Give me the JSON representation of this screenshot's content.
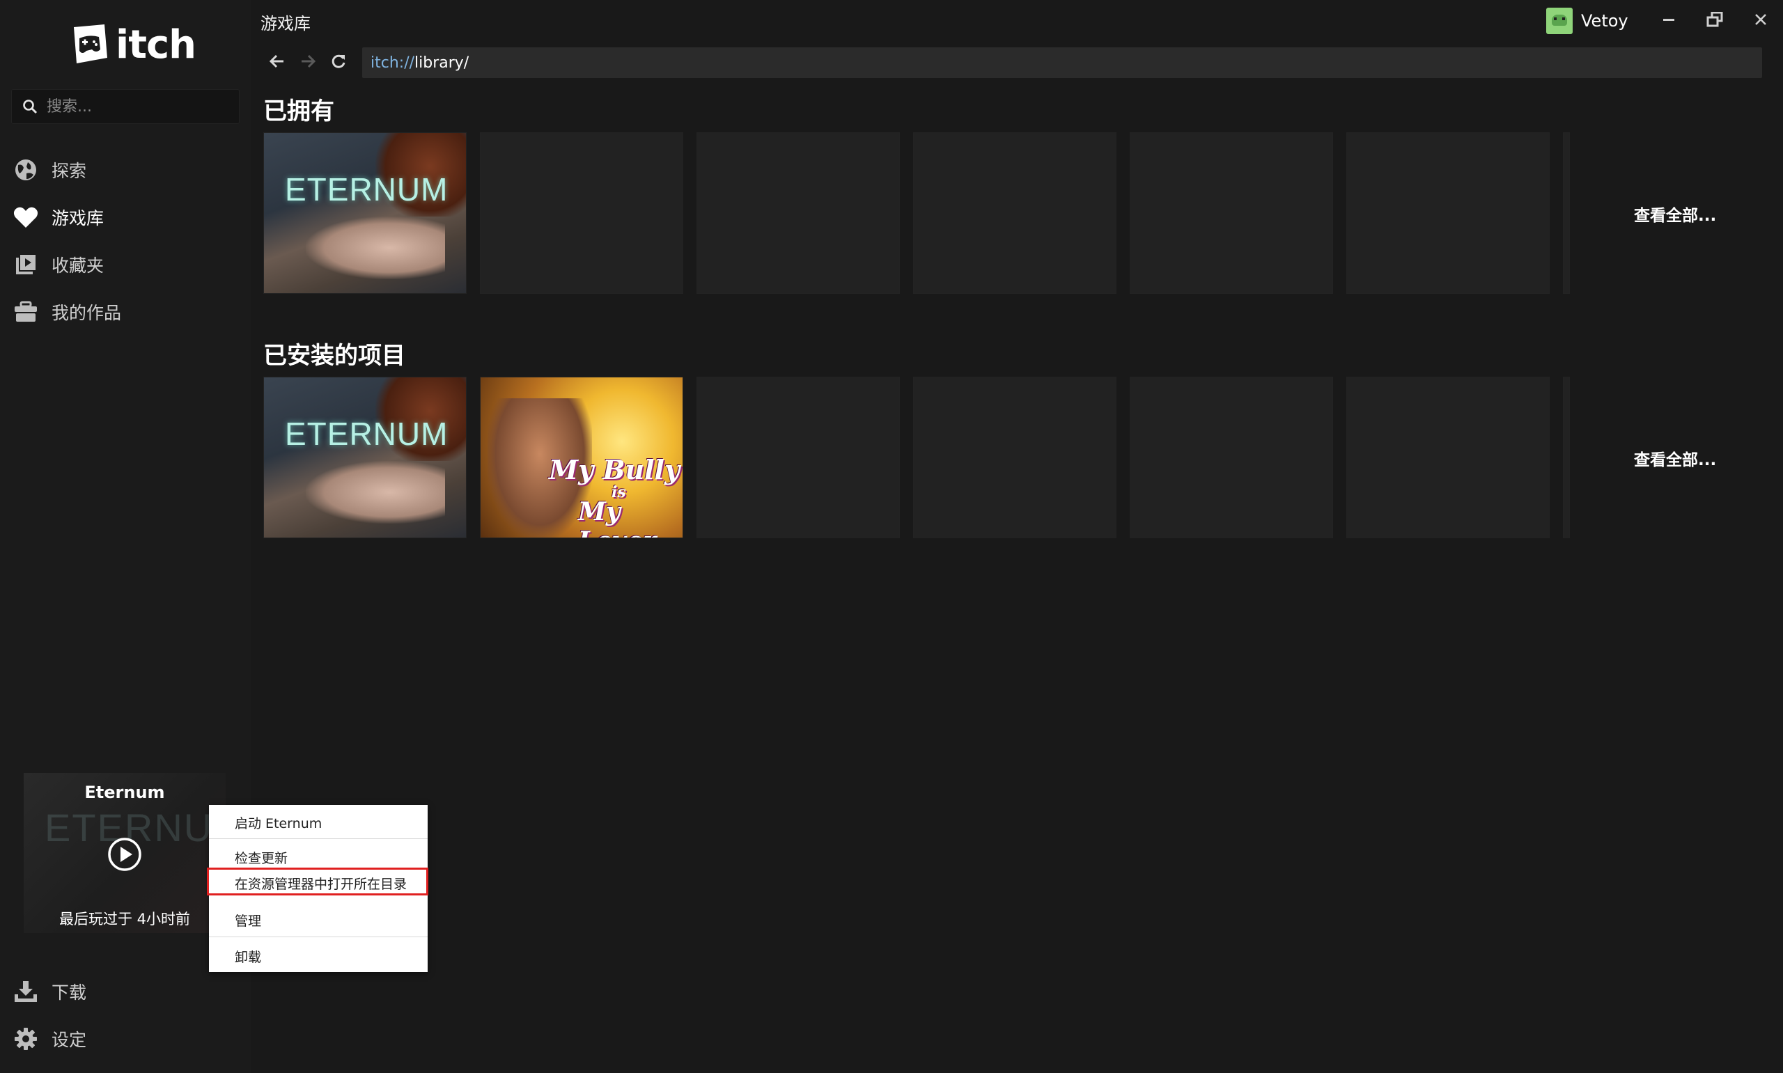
{
  "app": {
    "name": "itch",
    "page_title": "游戏库"
  },
  "user": {
    "name": "Vetoy"
  },
  "search": {
    "placeholder": "搜索..."
  },
  "sidebar": {
    "items": [
      {
        "label": "探索",
        "icon": "globe-icon"
      },
      {
        "label": "游戏库",
        "icon": "heart-icon",
        "active": true
      },
      {
        "label": "收藏夹",
        "icon": "collection-icon"
      },
      {
        "label": "我的作品",
        "icon": "briefcase-icon"
      }
    ],
    "bottom": [
      {
        "label": "下载",
        "icon": "download-icon"
      },
      {
        "label": "设定",
        "icon": "gear-icon"
      }
    ]
  },
  "address": {
    "protocol": "itch://",
    "path": "library/"
  },
  "sections": {
    "owned": {
      "title": "已拥有",
      "see_all": "查看全部..."
    },
    "installed": {
      "title": "已安装的项目",
      "see_all": "查看全部..."
    }
  },
  "games": {
    "eternum": {
      "cover_text": "ETERNUM"
    },
    "bully": {
      "cover_line1": "My Bully",
      "cover_line2": "is",
      "cover_line3": "My Lover"
    }
  },
  "recent": {
    "title": "Eternum",
    "bg_text": "ETERNUM",
    "last_played": "最后玩过于 4小时前"
  },
  "context_menu": {
    "items": [
      "启动 Eternum",
      "检查更新",
      "在资源管理器中打开所在目录",
      "管理",
      "卸载"
    ],
    "highlighted_index": 2,
    "highlight_color": "#e02020"
  },
  "colors": {
    "background": "#191919",
    "accent_link": "#7fb3e0"
  }
}
